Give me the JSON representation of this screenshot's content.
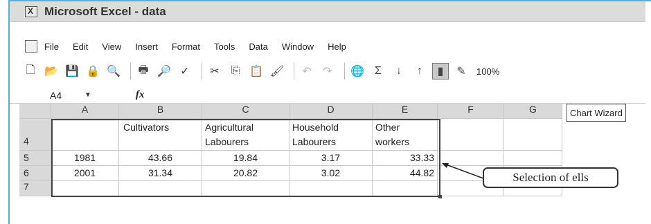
{
  "app": {
    "title": "Microsoft Excel - data"
  },
  "menu": [
    "File",
    "Edit",
    "View",
    "Insert",
    "Format",
    "Tools",
    "Data",
    "Window",
    "Help"
  ],
  "toolbar": {
    "zoom": "100%"
  },
  "formula_bar": {
    "cell_ref": "A4",
    "fx": "fx"
  },
  "sheet": {
    "columns": [
      "A",
      "B",
      "C",
      "D",
      "E",
      "F",
      "G"
    ],
    "rows": [
      {
        "num": "4",
        "cells": [
          "",
          "Cultivators",
          "Agricultural\nLabourers",
          "Household\nLabourers",
          "Other\nworkers",
          "",
          ""
        ]
      },
      {
        "num": "5",
        "cells": [
          "1981",
          "43.66",
          "19.84",
          "3.17",
          "33.33",
          "",
          ""
        ]
      },
      {
        "num": "6",
        "cells": [
          "2001",
          "31.34",
          "20.82",
          "3.02",
          "44.82",
          "",
          ""
        ]
      },
      {
        "num": "7",
        "cells": [
          "",
          "",
          "",
          "",
          "",
          "",
          ""
        ]
      }
    ]
  },
  "tooltip": "Chart Wizard",
  "callout": "Selection of ells"
}
